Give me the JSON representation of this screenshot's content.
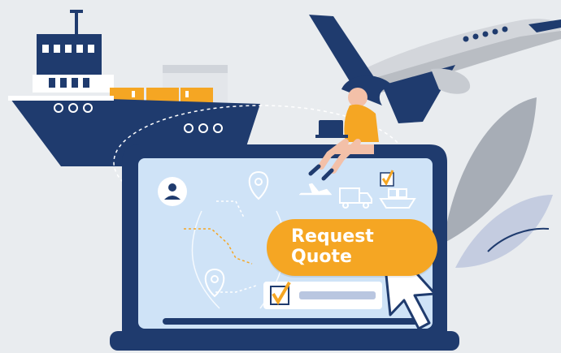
{
  "cta": {
    "line1": "Request",
    "line2": "Quote"
  },
  "colors": {
    "background": "#e9ecef",
    "navy": "#1f3b6e",
    "screen": "#cfe3f7",
    "accent_orange": "#f5a623",
    "white": "#ffffff"
  },
  "icons": [
    "cargo-ship-icon",
    "airplane-icon",
    "truck-icon",
    "user-avatar-icon",
    "location-pin-icon",
    "checkbox-checked-icon",
    "cursor-arrow-icon",
    "laptop-icon"
  ]
}
